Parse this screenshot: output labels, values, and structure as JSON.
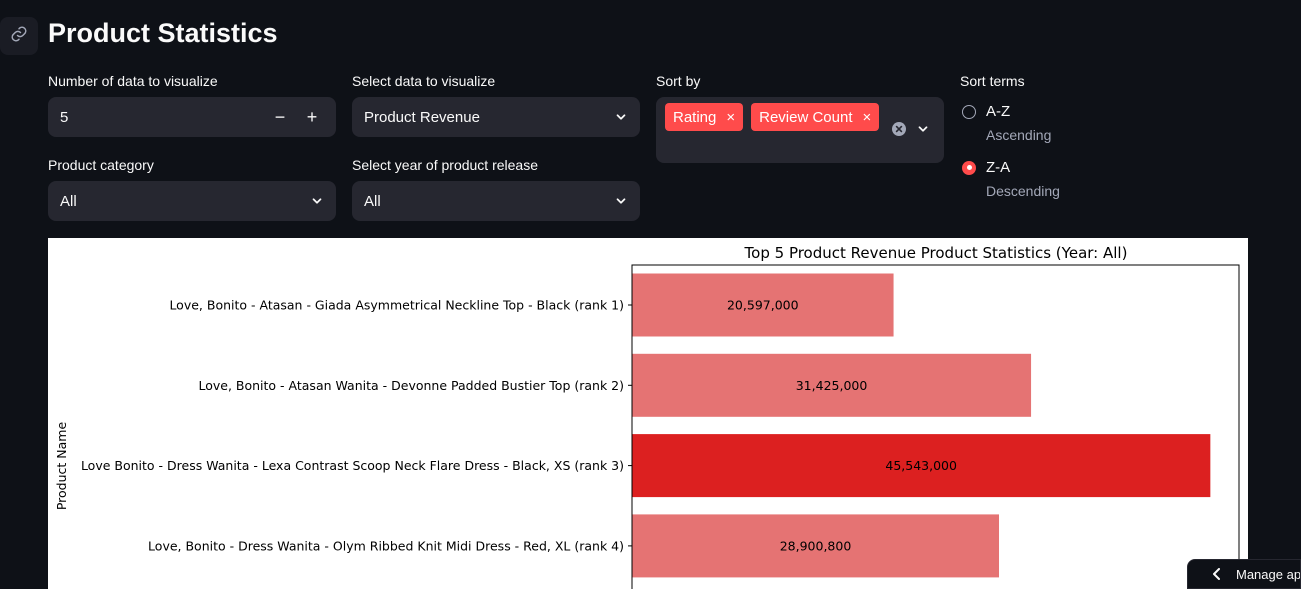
{
  "page": {
    "title": "Product Statistics"
  },
  "controls": {
    "num_data": {
      "label": "Number of data to visualize",
      "value": "5",
      "minus": "−",
      "plus": "+"
    },
    "select_data": {
      "label": "Select data to visualize",
      "value": "Product Revenue"
    },
    "sort_by": {
      "label": "Sort by",
      "tags": [
        "Rating",
        "Review Count"
      ]
    },
    "sort_terms": {
      "label": "Sort terms",
      "options": [
        {
          "label": "A-Z",
          "caption": "Ascending",
          "selected": false
        },
        {
          "label": "Z-A",
          "caption": "Descending",
          "selected": true
        }
      ]
    },
    "category": {
      "label": "Product category",
      "value": "All"
    },
    "year": {
      "label": "Select year of product release",
      "value": "All"
    }
  },
  "colors": {
    "accent": "#ff4b4b",
    "bar_normal": "#e57373",
    "bar_highlight": "#dc2020"
  },
  "chart_data": {
    "type": "bar",
    "orientation": "horizontal",
    "title": "Top 5 Product Revenue Product Statistics (Year: All)",
    "ylabel": "Product Name",
    "xlabel": "",
    "categories": [
      "Love, Bonito - Atasan - Giada Asymmetrical Neckline Top - Black (rank 1)",
      "Love, Bonito - Atasan Wanita - Devonne Padded Bustier Top (rank 2)",
      "Love Bonito - Dress Wanita - Lexa Contrast Scoop Neck Flare Dress - Black, XS (rank 3)",
      "Love, Bonito - Dress Wanita - Olym Ribbed Knit Midi Dress - Red, XL (rank 4)"
    ],
    "values": [
      20597000,
      31425000,
      45543000,
      28900800
    ],
    "value_labels": [
      "20,597,000",
      "31,425,000",
      "45,543,000",
      "28,900,800"
    ],
    "highlight_index": 2,
    "xlim": [
      0,
      47800000
    ]
  },
  "footer": {
    "manage_app": "Manage app"
  }
}
